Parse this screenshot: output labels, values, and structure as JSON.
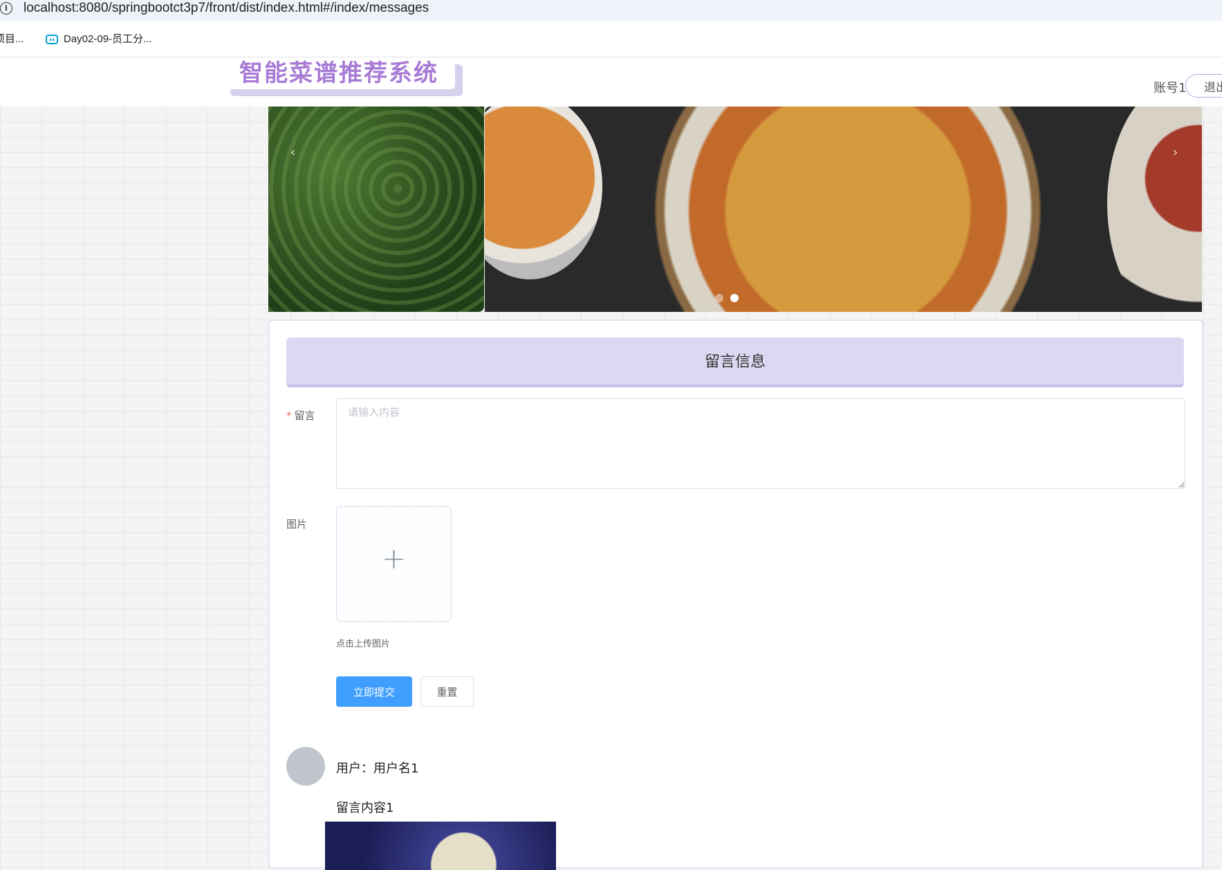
{
  "browser": {
    "url": "localhost:8080/springbootct3p7/front/dist/index.html#/index/messages",
    "bookmarks": [
      {
        "label": "项目..."
      },
      {
        "label": "Day02-09-员工分..."
      }
    ]
  },
  "header": {
    "logo": "智能菜谱推荐系统",
    "account": "账号1",
    "logout_label": "退出"
  },
  "carousel": {
    "prev_icon": "‹",
    "next_icon": "›",
    "dots": 2,
    "active_dot": 2
  },
  "form": {
    "title": "留言信息",
    "message_label": "留言",
    "message_placeholder": "请输入内容",
    "image_label": "图片",
    "upload_icon": "+",
    "upload_tip": "点击上传图片",
    "submit_label": "立即提交",
    "reset_label": "重置"
  },
  "comments": [
    {
      "user": "用户：用户名1",
      "content": "留言内容1"
    }
  ],
  "colors": {
    "primary": "#409eff",
    "title_bg": "#dcd8f2",
    "logo": "#a77bd6"
  }
}
